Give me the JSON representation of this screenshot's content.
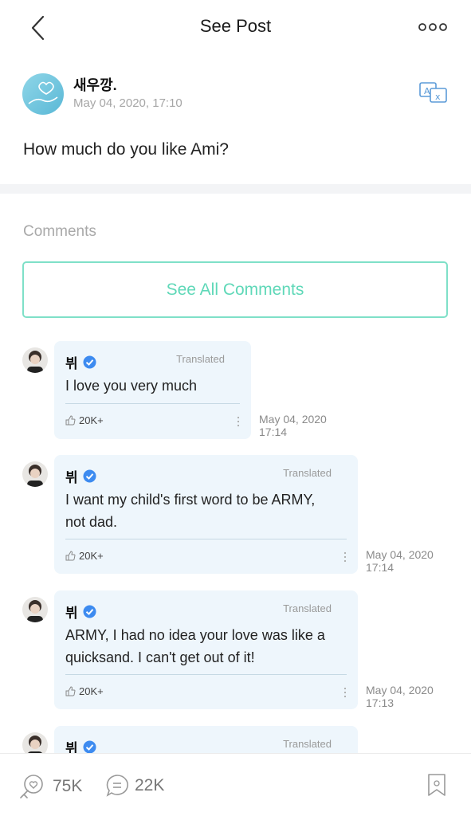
{
  "header": {
    "title": "See Post"
  },
  "post": {
    "author": "새우깡.",
    "date": "May 04, 2020, 17:10",
    "body": "How much do you like Ami?"
  },
  "comments_section": {
    "label": "Comments",
    "see_all_label": "See All Comments"
  },
  "comments": [
    {
      "author": "뷔",
      "translated_label": "Translated",
      "text": "I love you very much",
      "likes": "20K+",
      "date_line1": "May 04, 2020",
      "date_line2": "17:14"
    },
    {
      "author": "뷔",
      "translated_label": "Translated",
      "text_line1": "I want my child's first word to be ARMY,",
      "text_line2": "not dad.",
      "likes": "20K+",
      "date_line1": "May 04, 2020",
      "date_line2": "17:14"
    },
    {
      "author": "뷔",
      "translated_label": "Translated",
      "text_line1": "ARMY, I had no idea your love was like a",
      "text_line2": "quicksand. I can't get out of it!",
      "likes": "20K+",
      "date_line1": "May 04, 2020",
      "date_line2": "17:13"
    },
    {
      "author": "뷔",
      "translated_label": "Translated"
    }
  ],
  "bottom_bar": {
    "like_count": "75K",
    "comment_count": "22K"
  },
  "colors": {
    "accent_mint": "#5fd8b8",
    "verified_blue": "#3d8bf0",
    "bubble_bg": "#eef6fc"
  }
}
